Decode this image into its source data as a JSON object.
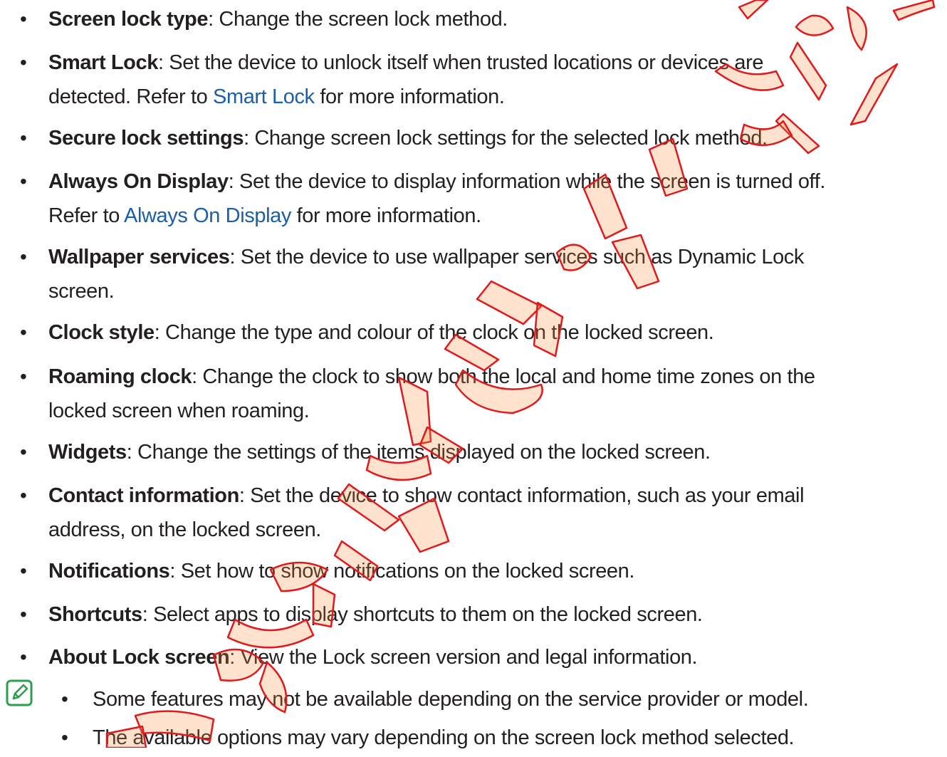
{
  "settings_list": [
    {
      "term": "Screen lock type",
      "desc": ": Change the screen lock method."
    },
    {
      "term": "Smart Lock",
      "desc": ": Set the device to unlock itself when trusted locations or devices are",
      "line2_pre": "detected. Refer to ",
      "link": "Smart Lock",
      "line2_post": " for more information."
    },
    {
      "term": "Secure lock settings",
      "desc": ": Change screen lock settings for the selected lock method."
    },
    {
      "term": "Always On Display",
      "desc": ": Set the device to display information while the screen is turned off.",
      "line2_pre": "Refer to ",
      "link": "Always On Display",
      "line2_post": " for more information."
    },
    {
      "term": "Wallpaper services",
      "desc": ": Set the device to use wallpaper services such as Dynamic Lock",
      "line2_pre": "screen."
    },
    {
      "term": "Clock style",
      "desc": ": Change the type and colour of the clock on the locked screen."
    },
    {
      "term": "Roaming clock",
      "desc": ": Change the clock to show both the local and home time zones on the",
      "line2_pre": "locked screen when roaming."
    },
    {
      "term": "Widgets",
      "desc": ": Change the settings of the items displayed on the locked screen."
    },
    {
      "term": "Contact information",
      "desc": ": Set the device to show contact information, such as your email",
      "line2_pre": "address, on the locked screen."
    },
    {
      "term": "Notifications",
      "desc": ": Set how to show notifications on the locked screen."
    },
    {
      "term": "Shortcuts",
      "desc": ": Select apps to display shortcuts to them on the locked screen."
    },
    {
      "term": "About Lock screen",
      "desc": ": View the Lock screen version and legal information."
    }
  ],
  "bullet_glyph": "•",
  "note": {
    "icon": "note-pencil-icon",
    "items": [
      "Some features may not be available depending on the service provider or model.",
      "The available options may vary depending on the screen lock method selected."
    ]
  },
  "colors": {
    "text": "#231f20",
    "link": "#1a5fa8",
    "note_icon": "#2e9e4f",
    "watermark_fill": "#ff8a3d",
    "watermark_stroke": "#e0191c"
  }
}
